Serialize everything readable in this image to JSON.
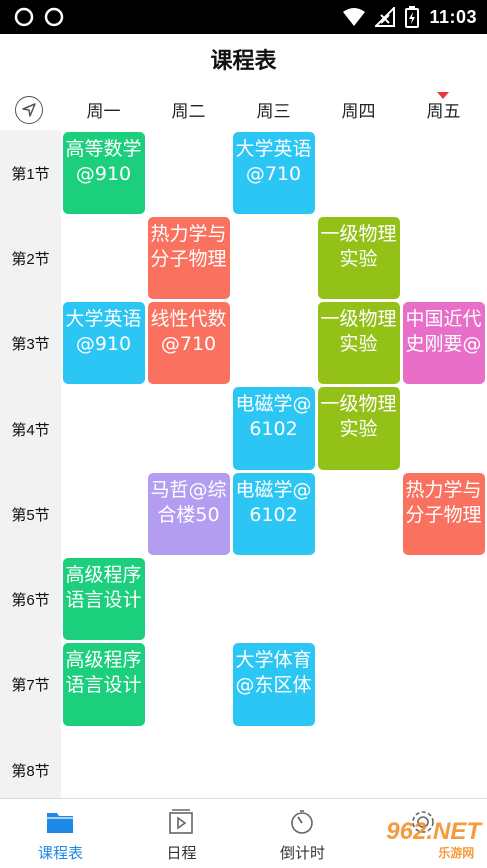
{
  "status_bar": {
    "time": "11:03"
  },
  "app": {
    "title": "课程表"
  },
  "week": {
    "days": [
      "周一",
      "周二",
      "周三",
      "周四",
      "周五"
    ],
    "today_index": 4
  },
  "periods": [
    "第1节",
    "第2节",
    "第3节",
    "第4节",
    "第5节",
    "第6节",
    "第7节",
    "第8节"
  ],
  "colors": {
    "green": "#1ccf7c",
    "blue": "#2bc6f3",
    "orange": "#fa725f",
    "lime": "#93c118",
    "pink": "#e86ec8",
    "purple": "#b39df0",
    "active_tab": "#1e88e5"
  },
  "courses": [
    {
      "day": 0,
      "start": 1,
      "span": 1,
      "text": "高等数学@910",
      "color": "green"
    },
    {
      "day": 2,
      "start": 1,
      "span": 1,
      "text": "大学英语@710",
      "color": "blue"
    },
    {
      "day": 1,
      "start": 2,
      "span": 1,
      "text": "热力学与分子物理",
      "color": "orange"
    },
    {
      "day": 3,
      "start": 2,
      "span": 1,
      "text": "一级物理实验",
      "color": "lime"
    },
    {
      "day": 0,
      "start": 3,
      "span": 1,
      "text": "大学英语@910",
      "color": "blue"
    },
    {
      "day": 1,
      "start": 3,
      "span": 1,
      "text": "线性代数@710",
      "color": "orange"
    },
    {
      "day": 3,
      "start": 3,
      "span": 1,
      "text": "一级物理实验",
      "color": "lime"
    },
    {
      "day": 4,
      "start": 3,
      "span": 1,
      "text": "中国近代史刚要@",
      "color": "pink"
    },
    {
      "day": 2,
      "start": 4,
      "span": 1,
      "text": "电磁学@6102",
      "color": "blue"
    },
    {
      "day": 3,
      "start": 4,
      "span": 1,
      "text": "一级物理实验",
      "color": "lime"
    },
    {
      "day": 1,
      "start": 5,
      "span": 1,
      "text": "马哲@综合楼50",
      "color": "purple"
    },
    {
      "day": 2,
      "start": 5,
      "span": 1,
      "text": "电磁学@6102",
      "color": "blue"
    },
    {
      "day": 4,
      "start": 5,
      "span": 1,
      "text": "热力学与分子物理",
      "color": "orange"
    },
    {
      "day": 0,
      "start": 6,
      "span": 1,
      "text": "高级程序语言设计",
      "color": "green"
    },
    {
      "day": 0,
      "start": 7,
      "span": 1,
      "text": "高级程序语言设计",
      "color": "green"
    },
    {
      "day": 2,
      "start": 7,
      "span": 1,
      "text": "大学体育@东区体",
      "color": "blue"
    }
  ],
  "nav": {
    "items": [
      {
        "label": "课程表",
        "icon": "folder-icon",
        "active": true
      },
      {
        "label": "日程",
        "icon": "calendar-play-icon",
        "active": false
      },
      {
        "label": "倒计时",
        "icon": "timer-icon",
        "active": false
      },
      {
        "label": "",
        "icon": "gear-icon",
        "active": false
      }
    ]
  },
  "watermark": {
    "brand": "962.NET",
    "sub": "乐游网"
  }
}
